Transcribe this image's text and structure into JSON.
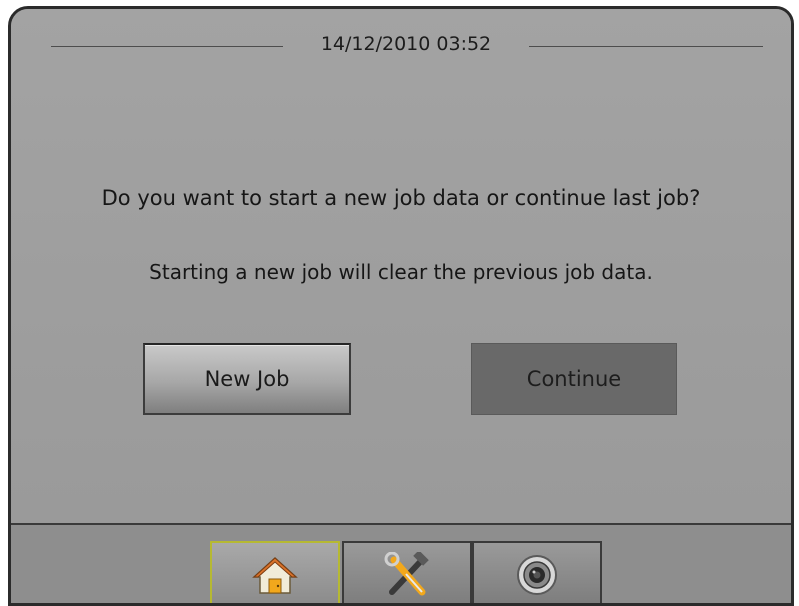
{
  "header": {
    "datetime": "14/12/2010 03:52"
  },
  "dialog": {
    "question": "Do you want to start a new job data or continue last job?",
    "note": "Starting a new job will clear the previous job data.",
    "new_job_label": "New Job",
    "continue_label": "Continue"
  },
  "navbar": {
    "tabs": [
      {
        "icon": "home-icon",
        "selected": true
      },
      {
        "icon": "tools-icon",
        "selected": false
      },
      {
        "icon": "camera-icon",
        "selected": false
      }
    ]
  },
  "colors": {
    "background": "#9d9d9d",
    "frame": "#2b2b2b",
    "selected_tab_outline": "#b6b932",
    "continue_button": "#696969"
  }
}
